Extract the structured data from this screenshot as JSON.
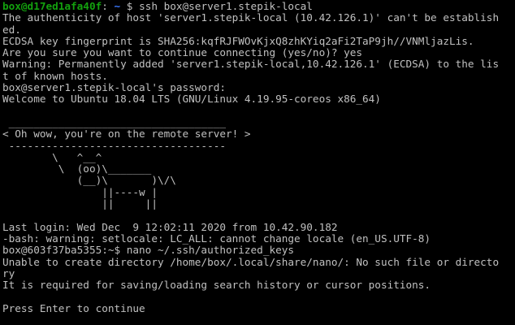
{
  "terminal": {
    "background": "#000000",
    "foreground": "#c0c0c0",
    "prompt_user_color": "#13a10e",
    "prompt_path_color": "#3b78ff",
    "prompt1": {
      "user_host": "box@d17ed1afa40f",
      "sep": ":",
      "path": " ~ ",
      "symbol": "$ ",
      "command": "ssh box@server1.stepik-local"
    },
    "lines": [
      "The authenticity of host 'server1.stepik-local (10.42.126.1)' can't be establish",
      "ed.",
      "ECDSA key fingerprint is SHA256:kqfRJFWOvKjxQ8zhKYiq2aFi2TaP9jh//VNMljazLis.",
      "Are you sure you want to continue connecting (yes/no)? yes",
      "Warning: Permanently added 'server1.stepik-local,10.42.126.1' (ECDSA) to the lis",
      "t of known hosts.",
      "box@server1.stepik-local's password:",
      "Welcome to Ubuntu 18.04 LTS (GNU/Linux 4.19.95-coreos x86_64)",
      "",
      " ___________________________________",
      "< Oh wow, you're on the remote server! >",
      " -----------------------------------",
      "        \\   ^__^",
      "         \\  (oo)\\_______",
      "            (__)\\       )\\/\\",
      "                ||----w |",
      "                ||     ||",
      "",
      "Last login: Wed Dec  9 12:02:11 2020 from 10.42.90.182",
      "-bash: warning: setlocale: LC_ALL: cannot change locale (en_US.UTF-8)",
      "box@603f37ba5355:~$ nano ~/.ssh/authorized_keys",
      "Unable to create directory /home/box/.local/share/nano/: No such file or directo",
      "ry",
      "It is required for saving/loading search history or cursor positions.",
      "",
      "Press Enter to continue"
    ]
  }
}
